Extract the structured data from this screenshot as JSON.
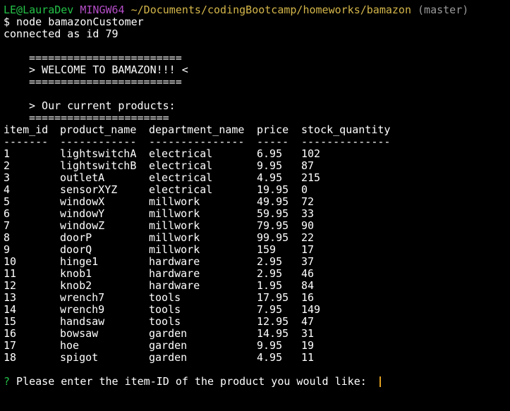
{
  "prompt_line": {
    "user_host": "LE@LauraDev",
    "shell": "MINGW64",
    "path": "~/Documents/codingBootcamp/homeworks/bamazon",
    "branch": "(master)"
  },
  "command": "$ node bamazonCustomer",
  "connected": "connected as id 79",
  "banner": {
    "border": "========================",
    "welcome": "> WELCOME TO BAMAZON!!! <"
  },
  "products_heading": "> Our current products:",
  "products_divider": "======================",
  "table": {
    "headers": [
      "item_id",
      "product_name",
      "department_name",
      "price",
      "stock_quantity"
    ],
    "dashes": [
      "-------",
      "------------",
      "---------------",
      "-----",
      "--------------"
    ],
    "rows": [
      [
        "1",
        "lightswitchA",
        "electrical",
        "6.95",
        "102"
      ],
      [
        "2",
        "lightswitchB",
        "electrical",
        "9.95",
        "87"
      ],
      [
        "3",
        "outletA",
        "electrical",
        "4.95",
        "215"
      ],
      [
        "4",
        "sensorXYZ",
        "electrical",
        "19.95",
        "0"
      ],
      [
        "5",
        "windowX",
        "millwork",
        "49.95",
        "72"
      ],
      [
        "6",
        "windowY",
        "millwork",
        "59.95",
        "33"
      ],
      [
        "7",
        "windowZ",
        "millwork",
        "79.95",
        "90"
      ],
      [
        "8",
        "doorP",
        "millwork",
        "99.95",
        "22"
      ],
      [
        "9",
        "doorQ",
        "millwork",
        "159",
        "17"
      ],
      [
        "10",
        "hinge1",
        "hardware",
        "2.95",
        "37"
      ],
      [
        "11",
        "knob1",
        "hardware",
        "2.95",
        "46"
      ],
      [
        "12",
        "knob2",
        "hardware",
        "1.95",
        "84"
      ],
      [
        "13",
        "wrench7",
        "tools",
        "17.95",
        "16"
      ],
      [
        "14",
        "wrench9",
        "tools",
        "7.95",
        "149"
      ],
      [
        "15",
        "handsaw",
        "tools",
        "12.95",
        "47"
      ],
      [
        "16",
        "bowsaw",
        "garden",
        "14.95",
        "31"
      ],
      [
        "17",
        "hoe",
        "garden",
        "9.95",
        "19"
      ],
      [
        "18",
        "spigot",
        "garden",
        "4.95",
        "11"
      ]
    ]
  },
  "question": {
    "mark": "?",
    "text": " Please enter the item-ID of the product you would like:"
  }
}
